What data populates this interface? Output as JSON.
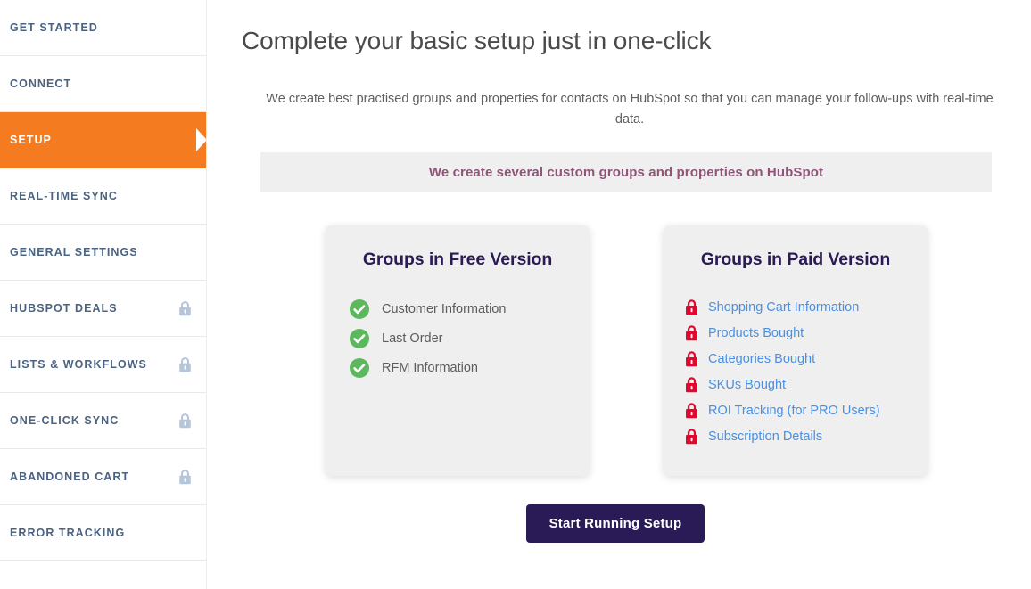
{
  "sidebar": {
    "items": [
      {
        "label": "GET STARTED",
        "locked": false,
        "active": false
      },
      {
        "label": "CONNECT",
        "locked": false,
        "active": false
      },
      {
        "label": "SETUP",
        "locked": false,
        "active": true
      },
      {
        "label": "REAL-TIME SYNC",
        "locked": false,
        "active": false
      },
      {
        "label": "GENERAL SETTINGS",
        "locked": false,
        "active": false
      },
      {
        "label": "HUBSPOT DEALS",
        "locked": true,
        "active": false
      },
      {
        "label": "LISTS & WORKFLOWS",
        "locked": true,
        "active": false
      },
      {
        "label": "ONE-CLICK SYNC",
        "locked": true,
        "active": false
      },
      {
        "label": "ABANDONED CART",
        "locked": true,
        "active": false
      },
      {
        "label": "ERROR TRACKING",
        "locked": false,
        "active": false
      }
    ],
    "lock_icon": "lock-icon",
    "active_color": "#f47b20",
    "label_color": "#4a6382"
  },
  "main": {
    "title": "Complete your basic setup just in one-click",
    "intro": "We create best practised groups and properties for contacts on HubSpot so that you can manage your follow-ups with real-time data.",
    "banner": "We create several custom groups and properties on HubSpot",
    "banner_color": "#8f5478",
    "cards": [
      {
        "title": "Groups in Free Version",
        "icon": "check-circle-icon",
        "icon_color": "#5cb85c",
        "items": [
          "Customer Information",
          "Last Order",
          "RFM Information"
        ]
      },
      {
        "title": "Groups in Paid Version",
        "icon": "lock-icon",
        "icon_color": "#e0082f",
        "items": [
          "Shopping Cart Information",
          "Products Bought",
          "Categories Bought",
          "SKUs Bought",
          "ROI Tracking (for PRO Users)",
          "Subscription Details"
        ]
      }
    ],
    "cta_label": "Start Running Setup",
    "cta_color": "#2a1a55"
  }
}
